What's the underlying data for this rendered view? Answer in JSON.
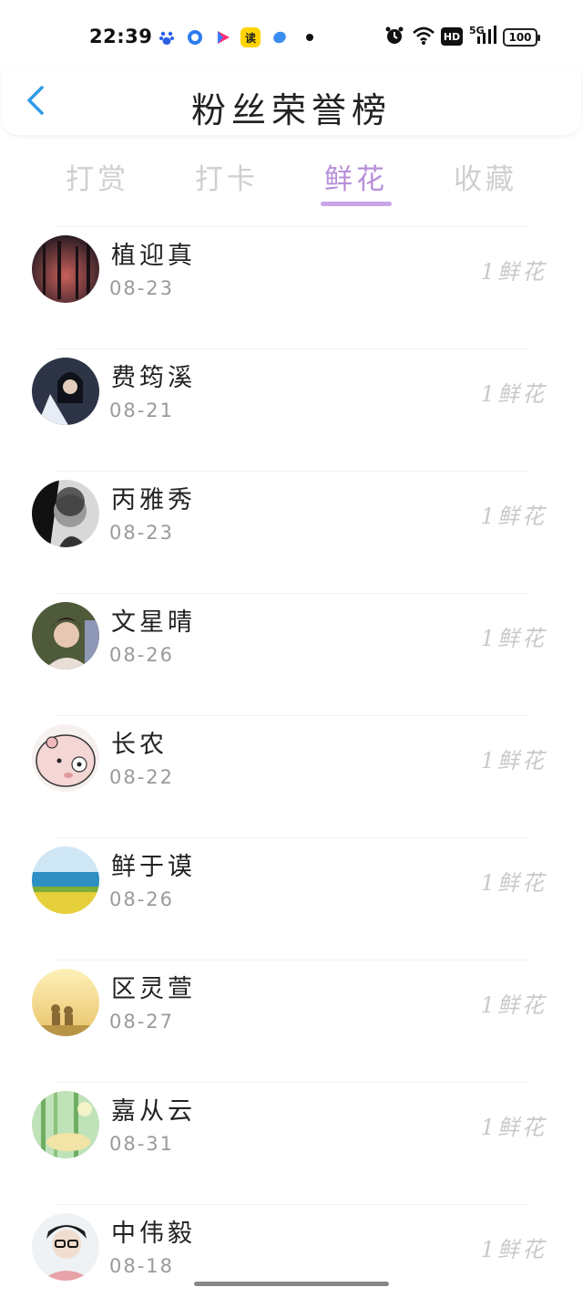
{
  "status_bar": {
    "time": "22:39",
    "network": "5G",
    "hd": "HD",
    "battery": "100",
    "app_icons": [
      "baidu-icon",
      "qq-browser-icon",
      "video-icon",
      "reader-icon",
      "feather-icon"
    ],
    "reader_icon_text": "读"
  },
  "header": {
    "title": "粉丝荣誉榜"
  },
  "tabs": [
    {
      "label": "打赏",
      "active": false
    },
    {
      "label": "打卡",
      "active": false
    },
    {
      "label": "鲜花",
      "active": true
    },
    {
      "label": "收藏",
      "active": false
    }
  ],
  "colors": {
    "accent": "#b88fd8",
    "underline": "#c8a4e6",
    "back": "#2e9be8"
  },
  "fans": [
    {
      "name": "植迎真",
      "date": "08-23",
      "amount": "1鲜花",
      "avatar": "dark-forest-avatar"
    },
    {
      "name": "费筠溪",
      "date": "08-21",
      "amount": "1鲜花",
      "avatar": "girl-portrait-avatar"
    },
    {
      "name": "丙雅秀",
      "date": "08-23",
      "amount": "1鲜花",
      "avatar": "bw-portrait-avatar"
    },
    {
      "name": "文星晴",
      "date": "08-26",
      "amount": "1鲜花",
      "avatar": "boy-portrait-avatar"
    },
    {
      "name": "长农",
      "date": "08-22",
      "amount": "1鲜花",
      "avatar": "cartoon-pig-avatar"
    },
    {
      "name": "鲜于谟",
      "date": "08-26",
      "amount": "1鲜花",
      "avatar": "seaside-field-avatar"
    },
    {
      "name": "区灵萱",
      "date": "08-27",
      "amount": "1鲜花",
      "avatar": "sunset-couple-avatar"
    },
    {
      "name": "嘉从云",
      "date": "08-31",
      "amount": "1鲜花",
      "avatar": "green-forest-avatar"
    },
    {
      "name": "中伟毅",
      "date": "08-18",
      "amount": "1鲜花",
      "avatar": "glasses-boy-avatar"
    }
  ]
}
